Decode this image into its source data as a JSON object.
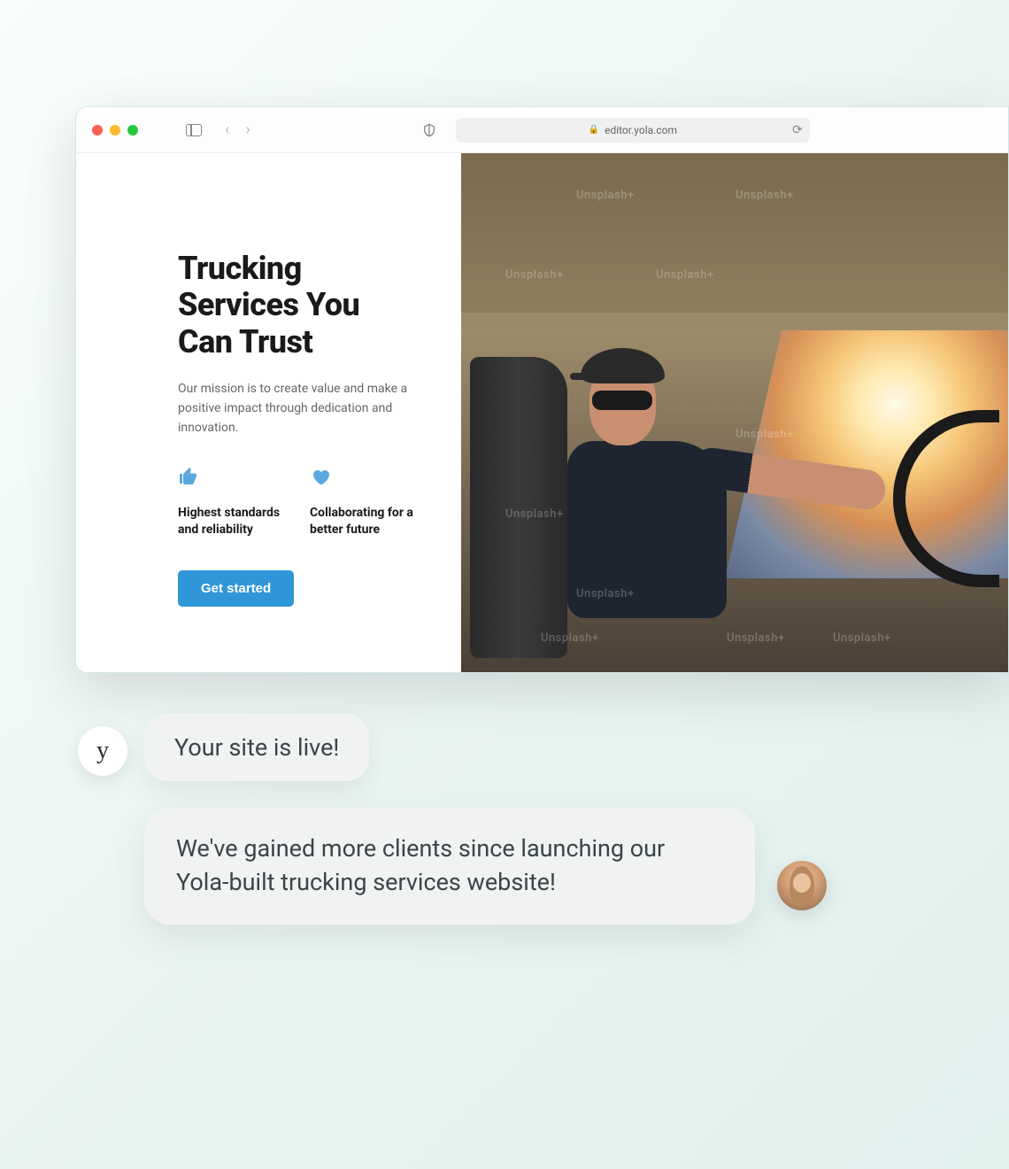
{
  "browser": {
    "url": "editor.yola.com"
  },
  "hero": {
    "title": "Trucking Services You Can Trust",
    "description": "Our mission is to create value and make a positive impact through dedication and innovation.",
    "cta_label": "Get started",
    "image_watermark": "Unsplash+"
  },
  "features": [
    {
      "icon": "thumbs-up",
      "label": "Highest standards and reliability"
    },
    {
      "icon": "heart",
      "label": "Collaborating for a better future"
    }
  ],
  "chat": {
    "logo_letter": "y",
    "bubble1": "Your site is live!",
    "bubble2": "We've gained more clients since launching our Yola-built trucking services website!"
  }
}
